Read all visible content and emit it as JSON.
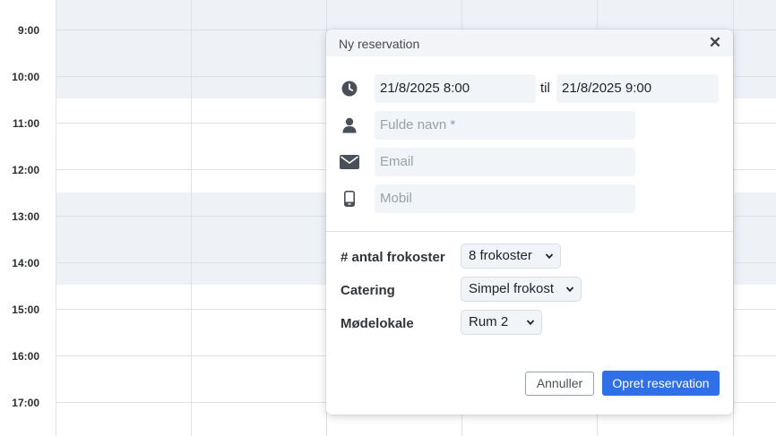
{
  "calendar": {
    "times": [
      "9:00",
      "10:00",
      "11:00",
      "12:00",
      "13:00",
      "14:00",
      "15:00",
      "16:00",
      "17:00"
    ]
  },
  "dialog": {
    "title": "Ny reservation",
    "close_label": "✕",
    "start_datetime": "21/8/2025  8:00",
    "until_label": "til",
    "end_datetime": "21/8/2025  9:00",
    "name_placeholder": "Fulde navn *",
    "email_placeholder": "Email",
    "mobile_placeholder": "Mobil",
    "options": {
      "lunches_label": "# antal frokoster",
      "lunches_value": "8 frokoster",
      "catering_label": "Catering",
      "catering_value": "Simpel frokost",
      "room_label": "Mødelokale",
      "room_value": "Rum 2"
    },
    "cancel_label": "Annuller",
    "submit_label": "Opret reservation"
  },
  "icons": [
    "clock-icon",
    "person-icon",
    "envelope-icon",
    "mobile-icon",
    "close-icon",
    "chevron-down-icon"
  ],
  "colors": {
    "primary": "#2f6fe8",
    "shade": "#eef2f7",
    "field": "#f1f4f8"
  }
}
